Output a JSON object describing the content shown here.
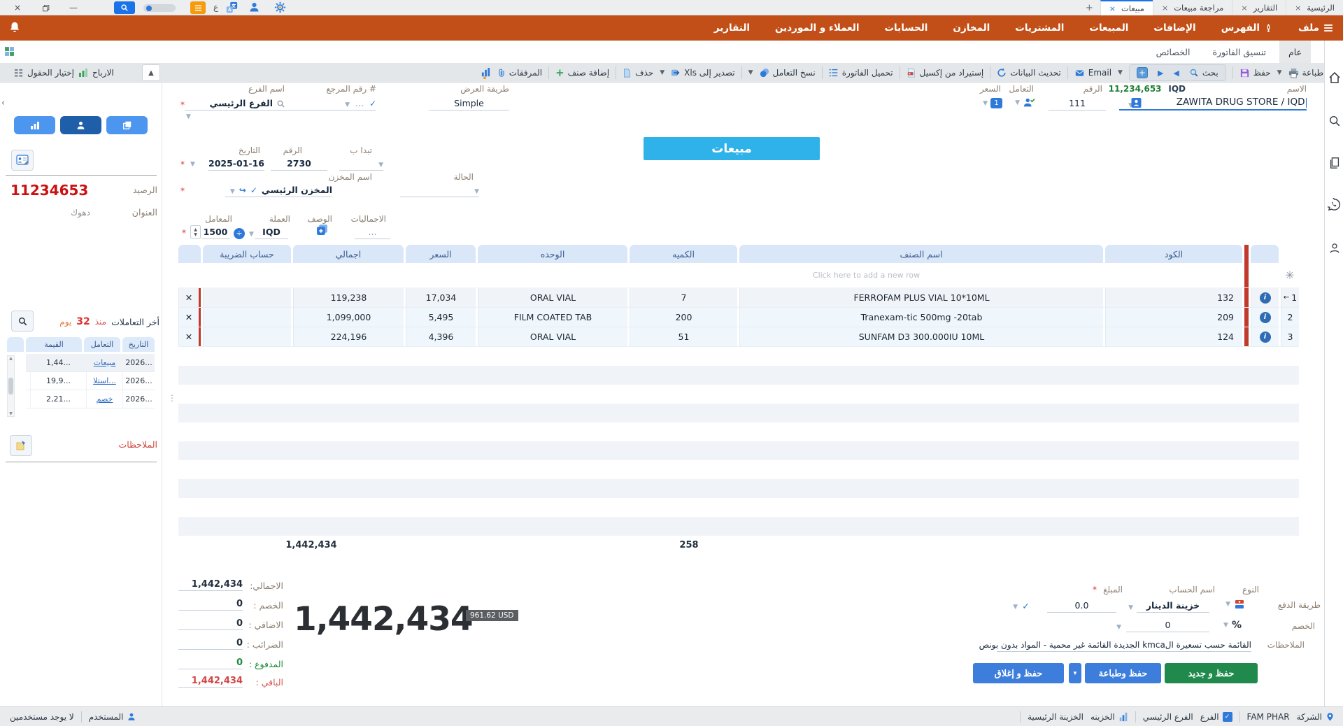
{
  "titlebar": {
    "tabs": [
      {
        "label": "الرئيسية"
      },
      {
        "label": "التقارير"
      },
      {
        "label": "مراجعة مبيعات"
      },
      {
        "label": "مبيعات"
      }
    ],
    "new_tab_label": "+",
    "lang_indicator": "ع"
  },
  "menubar": {
    "items": [
      "ملف",
      "الفهرس",
      "الإضافات",
      "المبيعات",
      "المشتريات",
      "المخازن",
      "الحسابات",
      "العملاء و الموردين",
      "التقارير"
    ]
  },
  "page_tabs": {
    "general": "عام",
    "invoice_format": "تنسيق الفاتورة",
    "properties": "الخصائص"
  },
  "toolbar": {
    "print": "طباعة",
    "save": "حفظ",
    "search": "بحث",
    "email": "Email",
    "refresh": "تحديث البيانات",
    "import_excel": "إستيراد من إكسيل",
    "load_invoice": "تحميل الفاتورة",
    "copy_transaction": "نسخ التعامل",
    "export_xls": "تصدير إلى Xls",
    "delete": "حذف",
    "add_item": "إضافة صنف",
    "attachments": "المرفقات",
    "choose_fields": "إختيار الحقول",
    "profits": "الارباح",
    "required_marker": "*"
  },
  "invoice": {
    "banner": "مبيعات",
    "name_label": "الاسم",
    "name_value": "ZAWITA DRUG STORE / IQD",
    "balance_hint": "11,234,653",
    "balance_currency": "IQD",
    "number_label": "الرقم",
    "number_value": "111",
    "dealing_label": "التعامل",
    "price_label": "السعر",
    "price_badge": "1",
    "display_label": "طريقة العرض",
    "display_value": "Simple",
    "ref_label": "رقم المرجع #",
    "ref_dots": "...",
    "branch_label": "اسم الفرع",
    "branch_value": "الفرع الرئيسي",
    "starts_label": "تبدا ب",
    "doc_number_label": "الرقم",
    "doc_number_value": "2730",
    "date_label": "التاريخ",
    "date_value": "2025-01-16",
    "status_label": "الحالة",
    "warehouse_label": "اسم المخزن",
    "warehouse_value": "المخزن الرئيسي",
    "totals_label": "الاجماليات",
    "totals_value": "...",
    "desc_label": "الوصف",
    "currency_label": "العملة",
    "currency_value": "IQD",
    "factor_label": "المعامل",
    "factor_value": "1500"
  },
  "table": {
    "headers": {
      "code": "الكود",
      "name": "اسم الصنف",
      "qty": "الكميه",
      "unit": "الوحده",
      "price": "السعر",
      "total": "اجمالي",
      "tax": "حساب الضريبة"
    },
    "add_row_hint": "Click here to add a new row",
    "rows": [
      {
        "num": "1",
        "code": "132",
        "name": "FERROFAM PLUS VIAL 10*10ML",
        "qty": "7",
        "unit": "ORAL VIAL",
        "price": "17,034",
        "total": "119,238"
      },
      {
        "num": "2",
        "code": "209",
        "name": "Tranexam-tic 500mg -20tab",
        "qty": "200",
        "unit": "FILM COATED TAB",
        "price": "5,495",
        "total": "1,099,000"
      },
      {
        "num": "3",
        "code": "124",
        "name": "SUNFAM D3 300.000IU 10ML",
        "qty": "51",
        "unit": "ORAL VIAL",
        "price": "4,396",
        "total": "224,196"
      }
    ],
    "sum_qty": "258",
    "sum_total": "1,442,434"
  },
  "summary": {
    "total_label": "الاجمالي:",
    "total_value": "1,442,434",
    "discount_label": "الخصم :",
    "discount_value": "0",
    "addition_label": "الاضافي :",
    "addition_value": "0",
    "taxes_label": "الضرائب :",
    "taxes_value": "0",
    "paid_label": "المدفوع :",
    "paid_value": "0",
    "remaining_label": "الباقي :",
    "remaining_value": "1,442,434",
    "grand_total": "1,442,434",
    "usd_equivalent": "961.62 USD"
  },
  "payment": {
    "type_label": "النوع",
    "account_label": "اسم الحساب",
    "account_value": "خزينة الدينار",
    "amount_label": "المبلغ",
    "amount_value": "0.0",
    "method_label": "طريقة الدفع",
    "discount_label": "الخصم",
    "discount_unit": "%",
    "discount_value": "0",
    "notes_label": "الملاحظات",
    "notes_value": "القائمة حسب تسعيرة الkmca الجديدة القائمة غير محمية - المواد بدون بونص"
  },
  "actions": {
    "save_new": "حفظ و جديد",
    "save_print": "حفظ وطباعة",
    "save_close": "حفظ و إغلاق"
  },
  "customer_panel": {
    "balance_label": "الرصيد",
    "balance_value": "11234653",
    "address_label": "العنوان",
    "address_value": "دهوك",
    "last_label": "أخر التعاملات",
    "since_label": "منذ",
    "since_value": "32",
    "since_unit": "يوم",
    "tx_headers": {
      "date": "التاريخ",
      "type": "التعامل",
      "value": "القيمة"
    },
    "tx_rows": [
      {
        "date": "2026...",
        "type": "مبيعات",
        "value": "1,44..."
      },
      {
        "date": "2026...",
        "type": "استلا...",
        "value": "19,9..."
      },
      {
        "date": "2026...",
        "type": "خصم",
        "value": "2,21..."
      }
    ],
    "notes_label": "الملاحظات"
  },
  "statusbar": {
    "company_label": "الشركة",
    "company_value": "FAM PHAR",
    "branch_label": "الفرع",
    "branch_value": "الفرع الرئيسي",
    "treasury_label": "الخزينه",
    "treasury_value": "الخزينة الرئيسية",
    "user_label": "المستخدم",
    "user_value": "لا يوجد مستخدمين"
  }
}
